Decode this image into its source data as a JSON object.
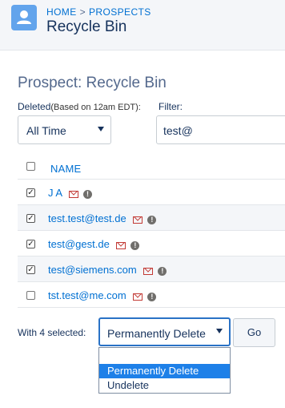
{
  "header": {
    "breadcrumb": [
      "HOME",
      "PROSPECTS"
    ],
    "title": "Recycle Bin"
  },
  "section_title": "Prospect: Recycle Bin",
  "filters": {
    "deleted_label": "Deleted",
    "deleted_note": "(Based on 12am EDT):",
    "deleted_value": "All Time",
    "filter_label": "Filter:",
    "filter_value": "test@"
  },
  "table": {
    "column_name": "NAME",
    "rows": [
      {
        "name": "J A",
        "checked": true
      },
      {
        "name": "test.test@test.de",
        "checked": true
      },
      {
        "name": "test@gest.de",
        "checked": true
      },
      {
        "name": "test@siemens.com",
        "checked": true
      },
      {
        "name": "tst.test@me.com",
        "checked": false
      }
    ]
  },
  "bulk": {
    "with_selected": "With 4 selected:",
    "action_value": "Permanently Delete",
    "go_label": "Go",
    "options": [
      "",
      "Permanently Delete",
      "Undelete"
    ],
    "highlighted_option": "Permanently Delete"
  },
  "colors": {
    "link": "#0070d2",
    "highlight": "#1e80e8",
    "mail_icon": "#c23934",
    "header_icon": "#62a4ec"
  },
  "icons": {
    "app": "person-icon",
    "mail": "mail-icon",
    "info": "info-icon",
    "caret": "chevron-down-icon"
  }
}
